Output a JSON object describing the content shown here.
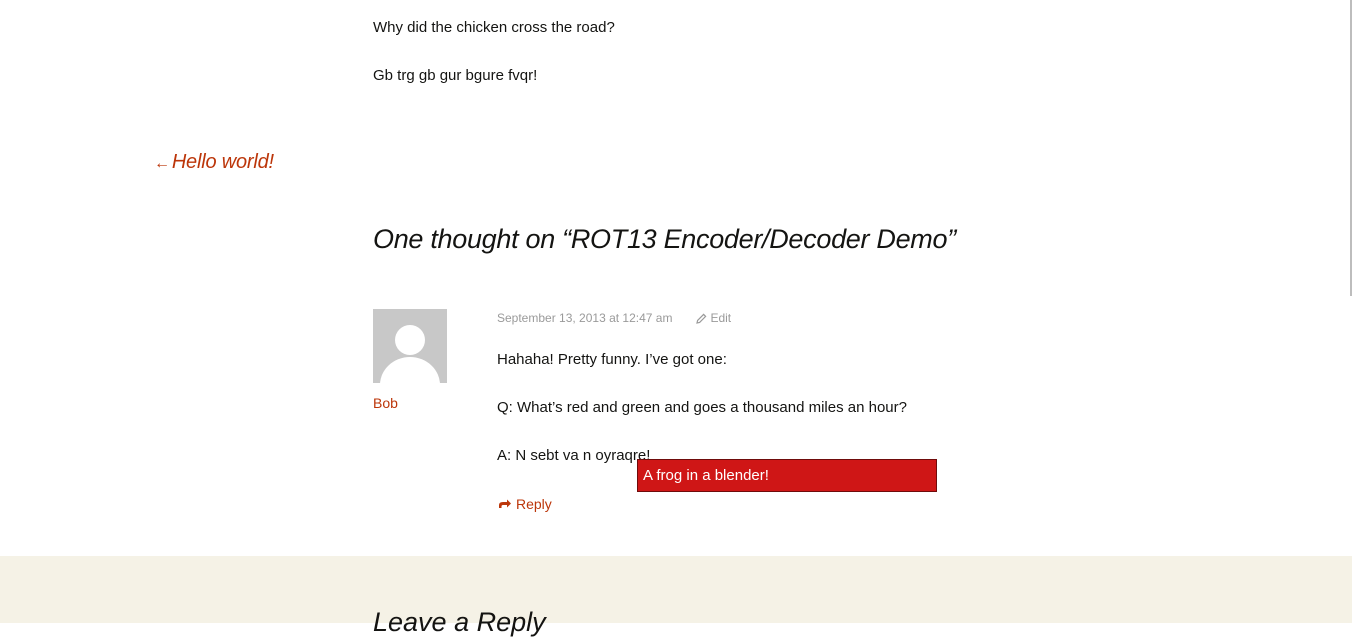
{
  "post": {
    "paragraphs": [
      "Why did the chicken cross the road?",
      "Gb trg gb gur bgure fvqr!"
    ]
  },
  "navigation": {
    "previous_arrow": "←",
    "previous_label": "Hello world!"
  },
  "comments": {
    "title": "One thought on “ROT13 Encoder/Decoder Demo”",
    "items": [
      {
        "author": "Bob",
        "date": "September 13, 2013 at 12:47 am",
        "edit_label": "Edit",
        "paragraphs": [
          "Hahaha! Pretty funny. I’ve got one:",
          "Q: What’s red and green and goes a thousand miles an hour?",
          "A: N sebt va n oyraqre!"
        ],
        "reply_label": "Reply"
      }
    ]
  },
  "tooltip": {
    "text": "A frog in a blender!"
  },
  "respond": {
    "title": "Leave a Reply"
  },
  "colors": {
    "link": "#bc360a",
    "tooltip_bg": "#cf1616",
    "band_bg": "#f5f2e6"
  },
  "icons": {
    "edit": "pencil-icon",
    "reply": "reply-arrow-icon",
    "avatar": "default-avatar-icon"
  }
}
